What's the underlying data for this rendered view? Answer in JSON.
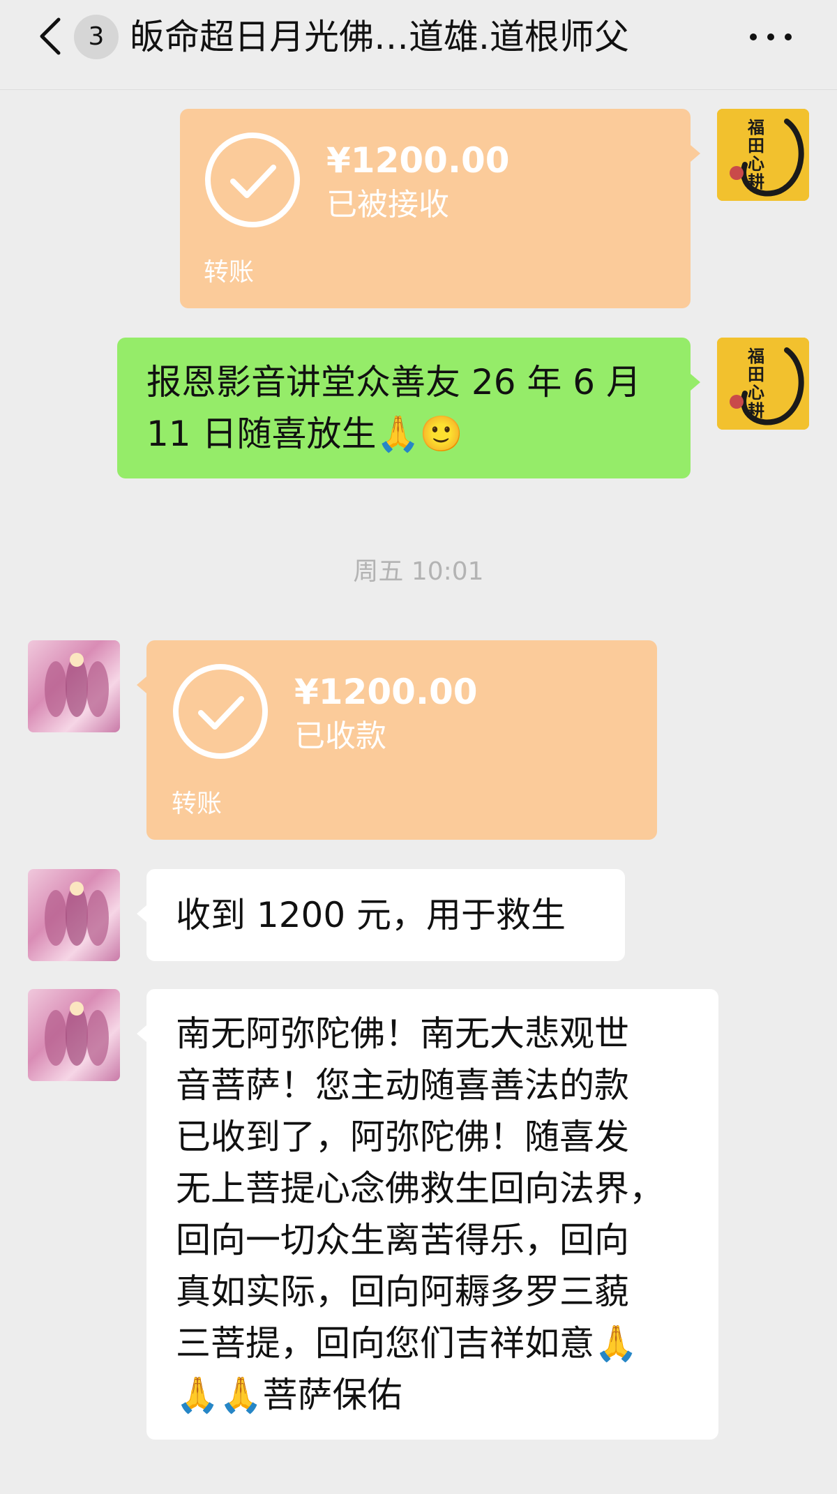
{
  "header": {
    "unread_count": "3",
    "title": "皈命超日月光佛…道雄.道根师父",
    "back_icon": "chevron-left-icon",
    "more_icon": "more-dots-icon"
  },
  "messages": {
    "m1": {
      "amount": "¥1200.00",
      "status": "已被接收",
      "label": "转账"
    },
    "m2": {
      "line1": "报恩影音讲堂众善友 26 年 6 月",
      "line2": "11 日随喜放生🙏🙂"
    },
    "timestamp": "周五 10:01",
    "m3": {
      "amount": "¥1200.00",
      "status": "已收款",
      "label": "转账"
    },
    "m4": {
      "text": "收到 1200 元，用于救生"
    },
    "m5": {
      "lines": [
        "南无阿弥陀佛！南无大悲观世",
        "音菩萨！您主动随喜善法的款",
        "已收到了，阿弥陀佛！随喜发",
        "无上菩提心念佛救生回向法界，",
        "回向一切众生离苦得乐，回向",
        "真如实际，回向阿耨多罗三藐",
        "三菩提，回向您们吉祥如意🙏",
        "🙏🙏菩萨保佑"
      ]
    }
  },
  "avatars": {
    "self_text": "福田心耕"
  },
  "colors": {
    "background": "#ededed",
    "transfer_bubble": "#fbcb9a",
    "sent_bubble": "#95ec69",
    "received_bubble": "#ffffff"
  }
}
